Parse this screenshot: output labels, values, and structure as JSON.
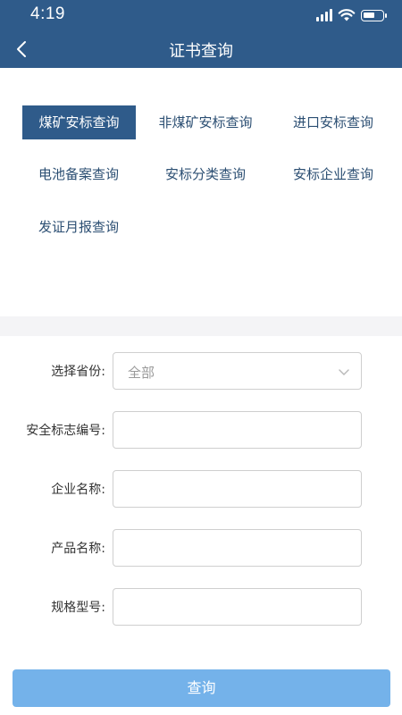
{
  "status_bar": {
    "time": "4:19"
  },
  "header": {
    "back_icon": "chevron-left-icon",
    "title": "证书查询"
  },
  "tabs": [
    {
      "label": "煤矿安标查询",
      "active": true
    },
    {
      "label": "非煤矿安标查询",
      "active": false
    },
    {
      "label": "进口安标查询",
      "active": false
    },
    {
      "label": "电池备案查询",
      "active": false
    },
    {
      "label": "安标分类查询",
      "active": false
    },
    {
      "label": "安标企业查询",
      "active": false
    },
    {
      "label": "发证月报查询",
      "active": false
    }
  ],
  "form": {
    "province": {
      "label": "选择省份:",
      "value": "全部"
    },
    "safety_mark_no": {
      "label": "安全标志编号:",
      "value": ""
    },
    "company_name": {
      "label": "企业名称:",
      "value": ""
    },
    "product_name": {
      "label": "产品名称:",
      "value": ""
    },
    "model": {
      "label": "规格型号:",
      "value": ""
    }
  },
  "submit_label": "查询",
  "colors": {
    "primary": "#2f5b8a",
    "button": "#74b2ea",
    "tab_text": "#2c4f73"
  }
}
